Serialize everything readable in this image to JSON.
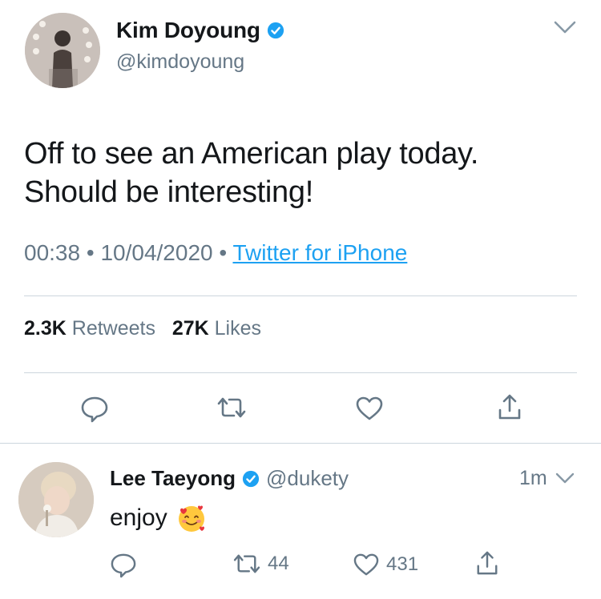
{
  "main_tweet": {
    "author_name": "Kim Doyoung",
    "author_handle": "@kimdoyoung",
    "text_line1": "Off to see an American play today.",
    "text_line2": "Should be interesting!",
    "time": "00:38",
    "date": "10/04/2020",
    "separator": "•",
    "source": "Twitter for iPhone",
    "retweets_count": "2.3K",
    "retweets_label": "Retweets",
    "likes_count": "27K",
    "likes_label": "Likes",
    "icons": [
      "reply-icon",
      "retweet-icon",
      "like-icon",
      "share-icon"
    ]
  },
  "reply": {
    "author_name": "Lee Taeyong",
    "author_handle": "@dukety",
    "time": "1m",
    "text": "enjoy",
    "emoji": "smiling-face-with-hearts",
    "retweet_count": "44",
    "like_count": "431"
  },
  "colors": {
    "accent": "#1da1f2",
    "secondary_text": "#657786",
    "primary_text": "#14171a",
    "divider": "#ccd6dd"
  }
}
